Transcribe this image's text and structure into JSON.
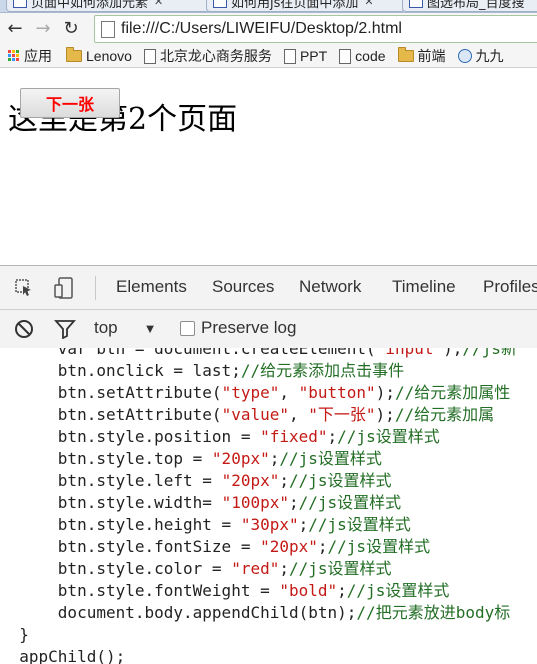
{
  "browser": {
    "tabs": [
      {
        "title": "页面中如何添加元素"
      },
      {
        "title": "如何用js往页面中添加"
      },
      {
        "title": "图选布局_百度搜"
      }
    ],
    "url": "file:///C:/Users/LIWEIFU/Desktop/2.html",
    "bookmarks": [
      {
        "label": "应用",
        "icon": "apps-icon"
      },
      {
        "label": "Lenovo",
        "icon": "folder-icon"
      },
      {
        "label": "北京龙心商务服务",
        "icon": "page-icon"
      },
      {
        "label": "PPT",
        "icon": "page-icon"
      },
      {
        "label": "code",
        "icon": "page-icon"
      },
      {
        "label": "前端",
        "icon": "folder-icon"
      },
      {
        "label": "九九",
        "icon": "globe-icon"
      }
    ]
  },
  "page": {
    "text": "这里是第2个页面",
    "button_label": "下一张"
  },
  "devtools": {
    "tabs": [
      "Elements",
      "Sources",
      "Network",
      "Timeline",
      "Profiles"
    ],
    "filter": {
      "context": "top",
      "preserve_log": "Preserve log"
    },
    "code_lines": [
      [
        {
          "t": "      var btn = document.createElement("
        },
        {
          "t": "\"input\"",
          "k": "s"
        },
        {
          "t": ");"
        },
        {
          "t": "//js新",
          "k": "c"
        }
      ],
      [
        {
          "t": "      btn.onclick = last;"
        },
        {
          "t": "//给元素添加点击事件",
          "k": "c"
        }
      ],
      [
        {
          "t": "      btn.setAttribute("
        },
        {
          "t": "\"type\"",
          "k": "s"
        },
        {
          "t": ", "
        },
        {
          "t": "\"button\"",
          "k": "s"
        },
        {
          "t": ");"
        },
        {
          "t": "//给元素加属性",
          "k": "c"
        }
      ],
      [
        {
          "t": "      btn.setAttribute("
        },
        {
          "t": "\"value\"",
          "k": "s"
        },
        {
          "t": ", "
        },
        {
          "t": "\"下一张\"",
          "k": "s"
        },
        {
          "t": ");"
        },
        {
          "t": "//给元素加属",
          "k": "c"
        }
      ],
      [
        {
          "t": "      btn.style.position = "
        },
        {
          "t": "\"fixed\"",
          "k": "s"
        },
        {
          "t": ";"
        },
        {
          "t": "//js设置样式",
          "k": "c"
        }
      ],
      [
        {
          "t": "      btn.style.top = "
        },
        {
          "t": "\"20px\"",
          "k": "s"
        },
        {
          "t": ";"
        },
        {
          "t": "//js设置样式",
          "k": "c"
        }
      ],
      [
        {
          "t": "      btn.style.left = "
        },
        {
          "t": "\"20px\"",
          "k": "s"
        },
        {
          "t": ";"
        },
        {
          "t": "//js设置样式",
          "k": "c"
        }
      ],
      [
        {
          "t": "      btn.style.width= "
        },
        {
          "t": "\"100px\"",
          "k": "s"
        },
        {
          "t": ";"
        },
        {
          "t": "//js设置样式",
          "k": "c"
        }
      ],
      [
        {
          "t": "      btn.style.height = "
        },
        {
          "t": "\"30px\"",
          "k": "s"
        },
        {
          "t": ";"
        },
        {
          "t": "//js设置样式",
          "k": "c"
        }
      ],
      [
        {
          "t": "      btn.style.fontSize = "
        },
        {
          "t": "\"20px\"",
          "k": "s"
        },
        {
          "t": ";"
        },
        {
          "t": "//js设置样式",
          "k": "c"
        }
      ],
      [
        {
          "t": "      btn.style.color = "
        },
        {
          "t": "\"red\"",
          "k": "s"
        },
        {
          "t": ";"
        },
        {
          "t": "//js设置样式",
          "k": "c"
        }
      ],
      [
        {
          "t": "      btn.style.fontWeight = "
        },
        {
          "t": "\"bold\"",
          "k": "s"
        },
        {
          "t": ";"
        },
        {
          "t": "//js设置样式",
          "k": "c"
        }
      ],
      [
        {
          "t": "      document.body.appendChild(btn);"
        },
        {
          "t": "//把元素放进body标",
          "k": "c"
        }
      ],
      [
        {
          "t": "  }"
        }
      ],
      [
        {
          "t": "  appChild();"
        }
      ]
    ]
  }
}
